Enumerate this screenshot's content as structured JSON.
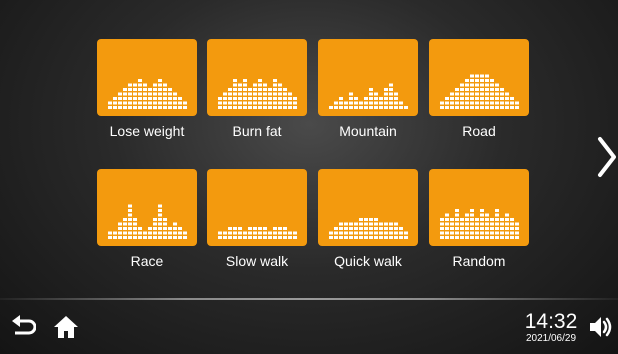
{
  "modes": [
    {
      "label": "Lose weight",
      "profile": [
        2,
        3,
        4,
        5,
        6,
        6,
        7,
        6,
        5,
        6,
        7,
        6,
        5,
        4,
        3,
        2
      ]
    },
    {
      "label": "Burn fat",
      "profile": [
        3,
        4,
        5,
        7,
        6,
        7,
        5,
        6,
        7,
        6,
        5,
        7,
        6,
        5,
        4,
        3
      ]
    },
    {
      "label": "Mountain",
      "profile": [
        1,
        2,
        3,
        2,
        4,
        3,
        2,
        3,
        5,
        4,
        3,
        5,
        6,
        4,
        2,
        1
      ]
    },
    {
      "label": "Road",
      "profile": [
        2,
        3,
        4,
        5,
        6,
        7,
        8,
        8,
        8,
        8,
        7,
        6,
        5,
        4,
        3,
        2
      ]
    },
    {
      "label": "Race",
      "profile": [
        2,
        2,
        4,
        5,
        8,
        5,
        3,
        2,
        3,
        5,
        8,
        5,
        3,
        4,
        3,
        2
      ]
    },
    {
      "label": "Slow walk",
      "profile": [
        2,
        2,
        3,
        3,
        3,
        2,
        3,
        3,
        3,
        3,
        2,
        3,
        3,
        3,
        2,
        2
      ]
    },
    {
      "label": "Quick walk",
      "profile": [
        2,
        3,
        4,
        4,
        4,
        4,
        5,
        5,
        5,
        5,
        4,
        4,
        4,
        4,
        3,
        2
      ]
    },
    {
      "label": "Random",
      "profile": [
        5,
        6,
        5,
        7,
        5,
        6,
        7,
        5,
        7,
        6,
        5,
        7,
        5,
        6,
        5,
        4
      ]
    }
  ],
  "status": {
    "time": "14:32",
    "date": "2021/06/29"
  },
  "colors": {
    "tile": "#f39a0e",
    "bars": "#ffffff"
  },
  "icons": {
    "next": "chevron-right-icon",
    "back": "back-arrow-icon",
    "home": "home-icon",
    "volume": "volume-icon"
  }
}
